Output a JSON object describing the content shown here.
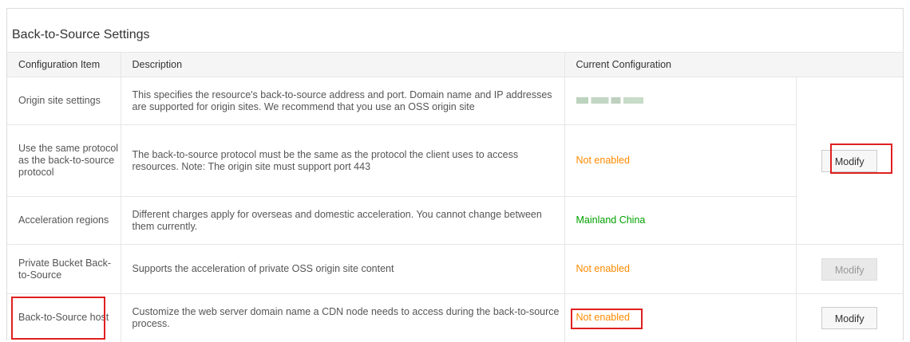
{
  "section_title": "Back-to-Source Settings",
  "columns": {
    "item": "Configuration Item",
    "description": "Description",
    "current": "Current Configuration"
  },
  "rows": [
    {
      "item": "Origin site settings",
      "description": "This specifies the resource's back-to-source address and port. Domain name and IP addresses are supported for origin sites. We recommend that you use an OSS origin site",
      "current": ""
    },
    {
      "item": "Use the same protocol as the back-to-source protocol",
      "description": "The back-to-source protocol must be the same as the protocol the client uses to access resources. Note: The origin site must support port 443",
      "current": "Not enabled"
    },
    {
      "item": "Acceleration regions",
      "description": "Different charges apply for overseas and domestic acceleration. You cannot change between them currently.",
      "current": "Mainland China"
    },
    {
      "item": "Private Bucket Back-to-Source",
      "description": "Supports the acceleration of private OSS origin site content",
      "current": "Not enabled"
    },
    {
      "item": "Back-to-Source host",
      "description": "Customize the web server domain name a CDN node needs to access during the back-to-source process.",
      "current": "Not enabled"
    }
  ],
  "buttons": {
    "modify_group": "Modify",
    "modify_private_bucket": "Modify",
    "modify_host": "Modify"
  },
  "colors": {
    "not_enabled": "#ff8a00",
    "enabled": "#00a000",
    "highlight": "#e02020"
  }
}
